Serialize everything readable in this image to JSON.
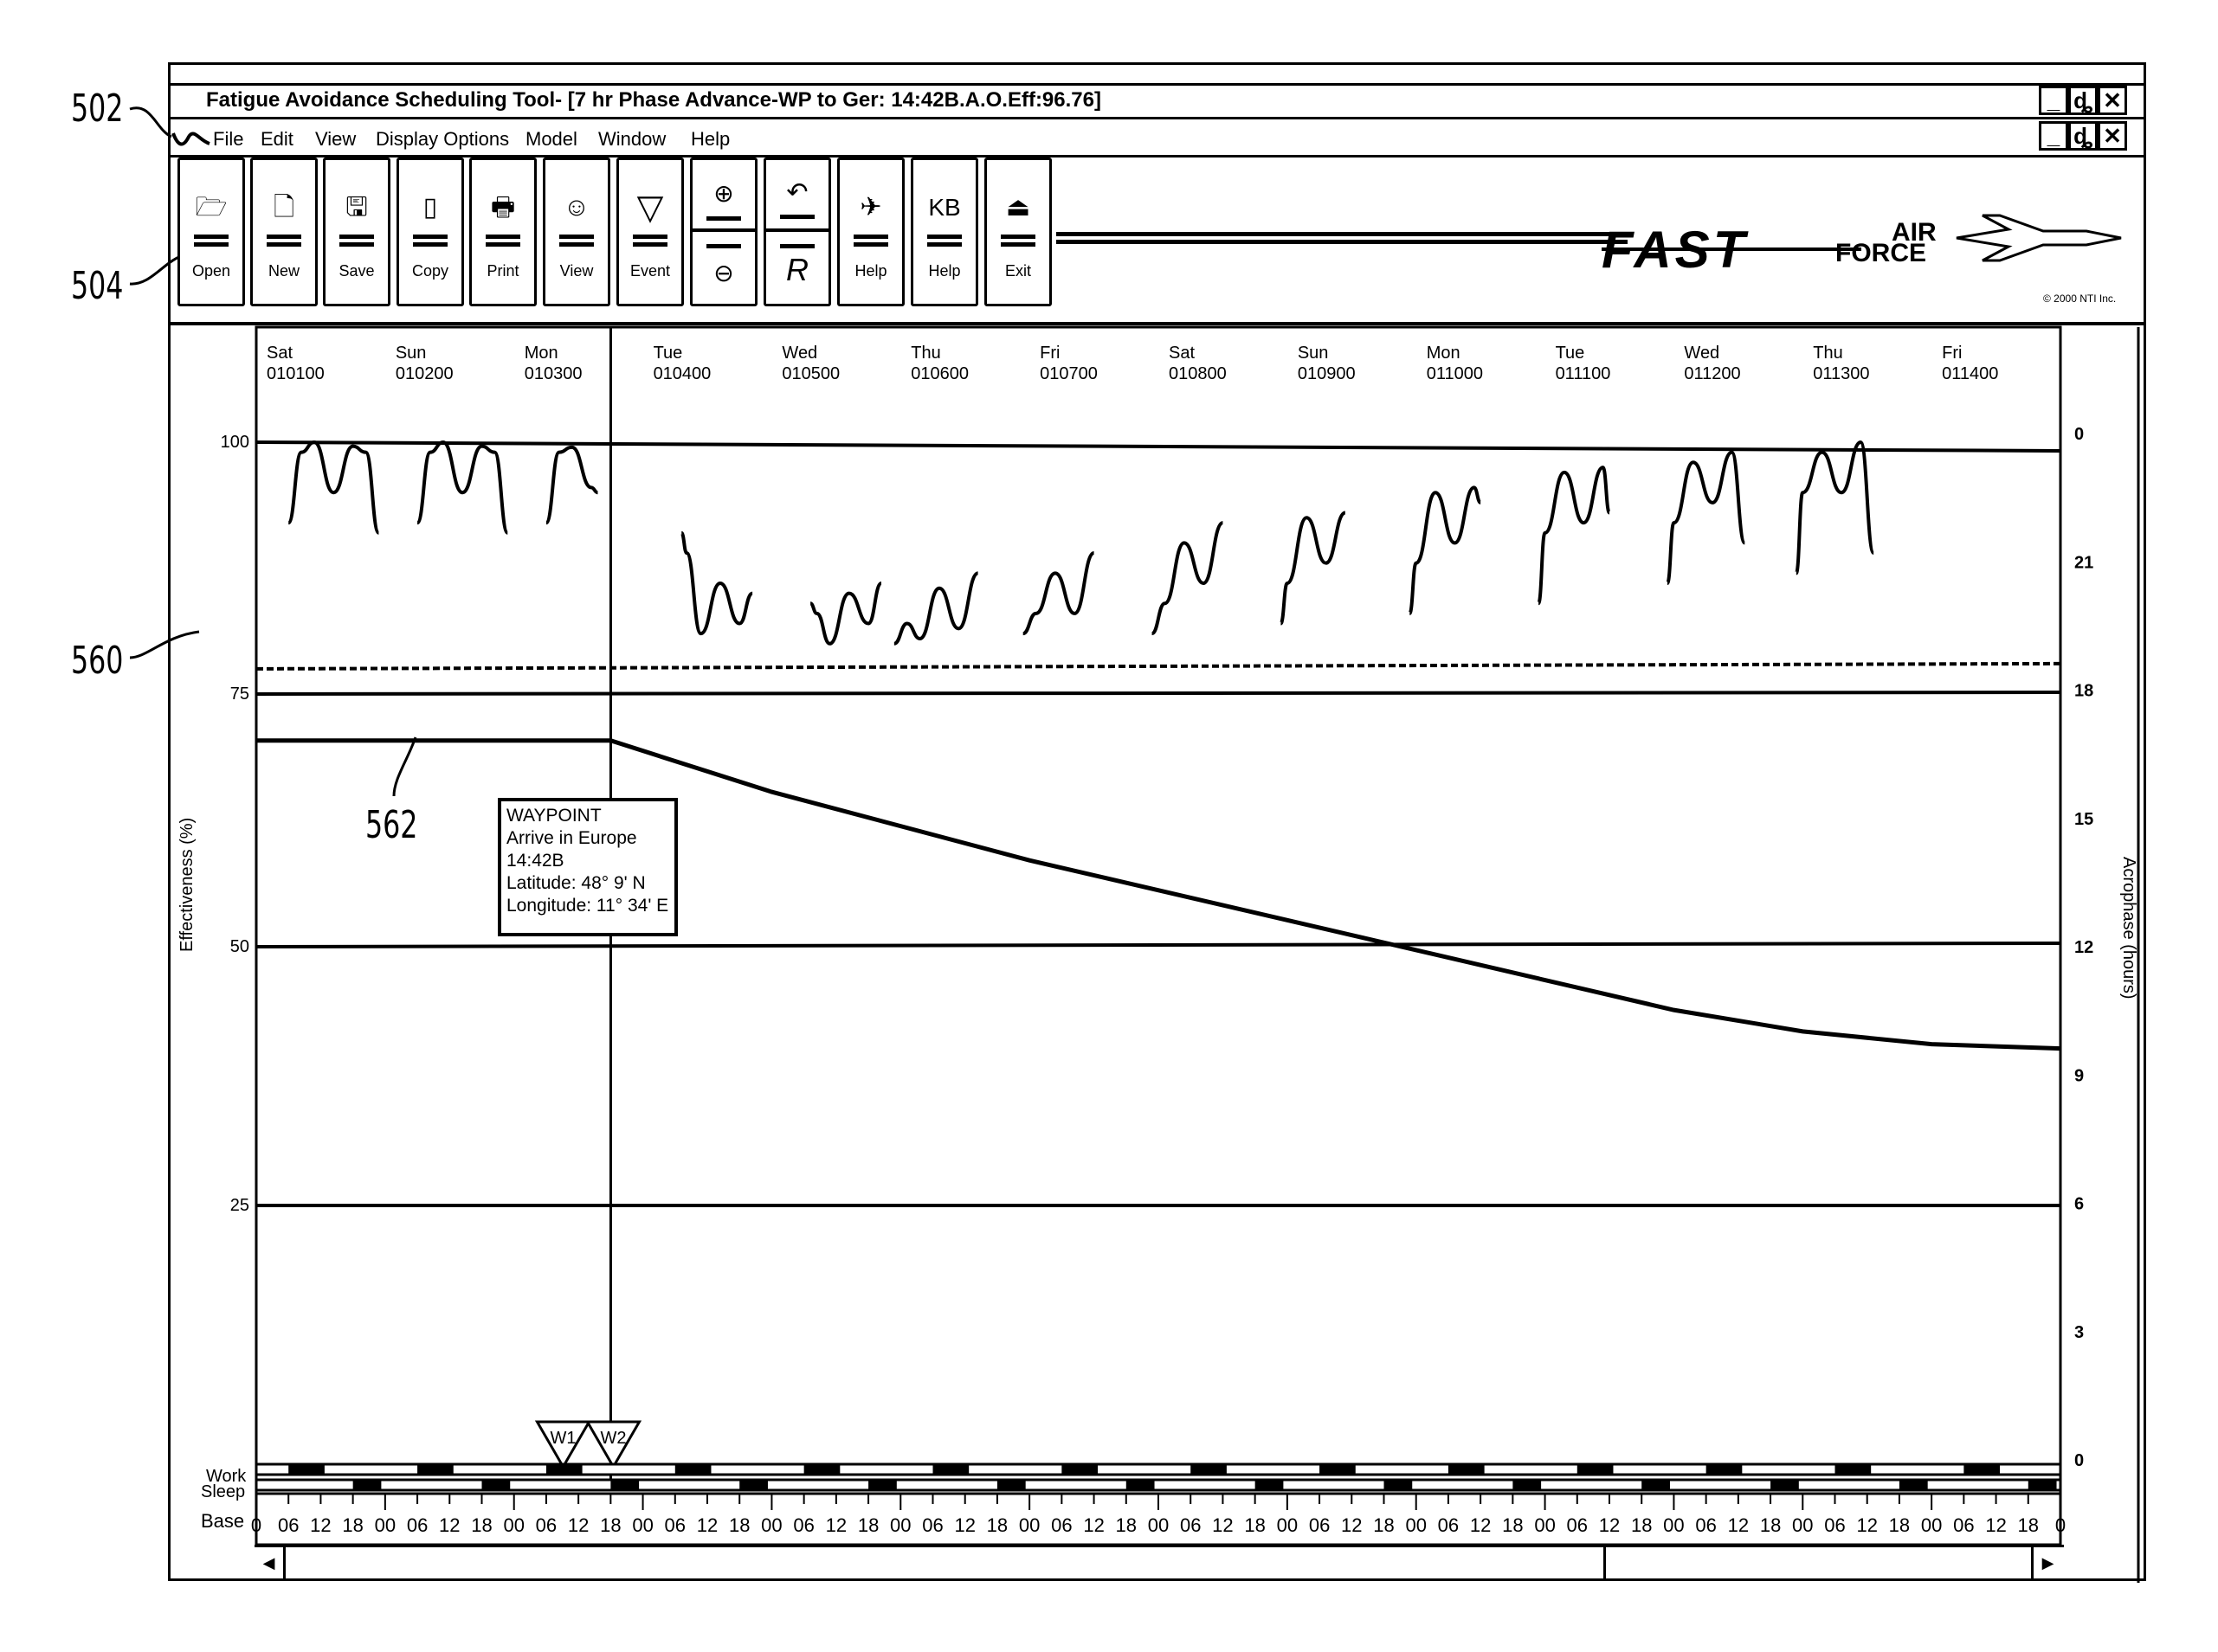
{
  "annotations": {
    "ref_502": "502",
    "ref_504": "504",
    "ref_560": "560",
    "ref_562": "562"
  },
  "window": {
    "title": "Fatigue Avoidance Scheduling Tool- [7 hr Phase Advance-WP to Ger: 14:42B.A.O.Eff:96.76]",
    "controls": {
      "minimize": "_",
      "restore": "ȡ",
      "close": "✕"
    }
  },
  "menu": {
    "app_icon": "wave-icon",
    "items": [
      "File",
      "Edit",
      "View",
      "Display Options",
      "Model",
      "Window",
      "Help"
    ]
  },
  "toolbar": {
    "buttons": [
      {
        "label": "Open",
        "icon": "open-folder-icon",
        "glyph": "🗁"
      },
      {
        "label": "New",
        "icon": "new-document-icon",
        "glyph": "🗋"
      },
      {
        "label": "Save",
        "icon": "save-disk-icon",
        "glyph": "🖫"
      },
      {
        "label": "Copy",
        "icon": "copy-icon",
        "glyph": "▯"
      },
      {
        "label": "Print",
        "icon": "printer-icon",
        "glyph": "🖶"
      },
      {
        "label": "View",
        "icon": "view-character-icon",
        "glyph": "☺"
      },
      {
        "label": "Event",
        "icon": "event-triangle-icon",
        "glyph": "▽"
      },
      {
        "label": "",
        "icon": "zoom-icon",
        "glyph_top": "⊕",
        "glyph_bottom": "⊖"
      },
      {
        "label": "",
        "icon": "undo-reset-icon",
        "glyph_top": "↶",
        "glyph_bottom": "R"
      },
      {
        "label": "Help",
        "icon": "aircraft-help-icon",
        "glyph": "✈"
      },
      {
        "label": "Help",
        "icon": "kb-help-icon",
        "glyph": "KB"
      },
      {
        "label": "Exit",
        "icon": "exit-door-icon",
        "glyph": "⏏"
      }
    ]
  },
  "logo": {
    "fast": "FAST",
    "air": "AIR",
    "force": "FORCE",
    "copyright": "© 2000 NTI Inc."
  },
  "chart_data": {
    "type": "line",
    "title": "",
    "ylabel": "Effectiveness (%)",
    "y2label": "Acrophase (hours)",
    "ylim": [
      0,
      100
    ],
    "y2lim": [
      0,
      24
    ],
    "yticks": [
      100,
      75,
      50,
      25
    ],
    "y2ticks": [
      "0",
      "21",
      "18",
      "15",
      "12",
      "9",
      "6",
      "3",
      "0"
    ],
    "days": [
      {
        "day": "Sat",
        "date": "010100"
      },
      {
        "day": "Sun",
        "date": "010200"
      },
      {
        "day": "Mon",
        "date": "010300"
      },
      {
        "day": "Tue",
        "date": "010400"
      },
      {
        "day": "Wed",
        "date": "010500"
      },
      {
        "day": "Thu",
        "date": "010600"
      },
      {
        "day": "Fri",
        "date": "010700"
      },
      {
        "day": "Sat",
        "date": "010800"
      },
      {
        "day": "Sun",
        "date": "010900"
      },
      {
        "day": "Mon",
        "date": "011000"
      },
      {
        "day": "Tue",
        "date": "011100"
      },
      {
        "day": "Wed",
        "date": "011200"
      },
      {
        "day": "Thu",
        "date": "011300"
      },
      {
        "day": "Fri",
        "date": "011400"
      }
    ],
    "threshold_dashed": 77.5,
    "waypoint_day": 2.65,
    "series": [
      {
        "name": "Effectiveness",
        "segments": [
          [
            [
              0.25,
              92
            ],
            [
              0.35,
              99
            ],
            [
              0.45,
              100
            ],
            [
              0.6,
              95
            ],
            [
              0.75,
              99.6
            ],
            [
              0.85,
              99
            ],
            [
              0.95,
              91
            ]
          ],
          [
            [
              1.25,
              92
            ],
            [
              1.35,
              99
            ],
            [
              1.45,
              100
            ],
            [
              1.6,
              95
            ],
            [
              1.75,
              99.6
            ],
            [
              1.85,
              99
            ],
            [
              1.95,
              91
            ]
          ],
          [
            [
              2.25,
              92
            ],
            [
              2.35,
              99
            ],
            [
              2.45,
              99.5
            ],
            [
              2.6,
              95.5
            ],
            [
              2.65,
              95
            ]
          ],
          [
            [
              3.3,
              91
            ],
            [
              3.34,
              89
            ],
            [
              3.45,
              81
            ],
            [
              3.6,
              86
            ],
            [
              3.75,
              82
            ],
            [
              3.85,
              85
            ]
          ],
          [
            [
              4.3,
              84
            ],
            [
              4.35,
              83
            ],
            [
              4.45,
              80
            ],
            [
              4.6,
              85
            ],
            [
              4.75,
              82
            ],
            [
              4.85,
              86
            ]
          ],
          [
            [
              4.95,
              80
            ],
            [
              5.05,
              82
            ],
            [
              5.15,
              80.5
            ],
            [
              5.3,
              85.5
            ],
            [
              5.45,
              81.5
            ],
            [
              5.6,
              87
            ]
          ],
          [
            [
              5.95,
              81
            ],
            [
              6.05,
              83
            ],
            [
              6.2,
              87
            ],
            [
              6.35,
              83
            ],
            [
              6.5,
              89
            ]
          ],
          [
            [
              6.95,
              81
            ],
            [
              7.05,
              84
            ],
            [
              7.2,
              90
            ],
            [
              7.35,
              86
            ],
            [
              7.5,
              92
            ]
          ],
          [
            [
              7.95,
              82
            ],
            [
              8.0,
              86
            ],
            [
              8.15,
              92.5
            ],
            [
              8.3,
              88
            ],
            [
              8.45,
              93
            ]
          ],
          [
            [
              8.95,
              83
            ],
            [
              9.0,
              88
            ],
            [
              9.15,
              95
            ],
            [
              9.3,
              90
            ],
            [
              9.45,
              95.5
            ],
            [
              9.5,
              94
            ]
          ],
          [
            [
              9.95,
              84
            ],
            [
              10.0,
              91
            ],
            [
              10.15,
              97
            ],
            [
              10.3,
              92
            ],
            [
              10.45,
              97.5
            ],
            [
              10.5,
              93
            ]
          ],
          [
            [
              10.95,
              86
            ],
            [
              11.0,
              92
            ],
            [
              11.15,
              98
            ],
            [
              11.3,
              94
            ],
            [
              11.45,
              99
            ],
            [
              11.55,
              90
            ]
          ],
          [
            [
              11.95,
              87
            ],
            [
              12.0,
              95
            ],
            [
              12.15,
              99
            ],
            [
              12.3,
              95
            ],
            [
              12.45,
              100
            ],
            [
              12.55,
              89
            ]
          ]
        ]
      },
      {
        "name": "Acrophase",
        "axis": "right",
        "points": [
          [
            0,
            16.8
          ],
          [
            2.65,
            16.8
          ],
          [
            4,
            15.6
          ],
          [
            6,
            14
          ],
          [
            8,
            12.6
          ],
          [
            10,
            11.2
          ],
          [
            11,
            10.5
          ],
          [
            12,
            10
          ],
          [
            13,
            9.7
          ],
          [
            14,
            9.6
          ]
        ]
      }
    ],
    "waypoint_markers": [
      "W1",
      "W2"
    ],
    "row_labels": {
      "work": "Work",
      "sleep": "Sleep",
      "base": "Base"
    },
    "base_ticks": [
      "0",
      "06",
      "12",
      "18",
      "00",
      "06",
      "12",
      "18",
      "00",
      "06",
      "12",
      "18",
      "00",
      "06",
      "12",
      "18",
      "00",
      "06",
      "12",
      "18",
      "00",
      "06",
      "12",
      "18",
      "00",
      "06",
      "12",
      "18",
      "00",
      "06",
      "12",
      "18",
      "00",
      "06",
      "12",
      "18",
      "00",
      "06",
      "12",
      "18",
      "00",
      "06",
      "12",
      "18",
      "00",
      "06",
      "12",
      "18",
      "00",
      "06",
      "12",
      "18",
      "00",
      "06",
      "12",
      "18",
      "0"
    ]
  },
  "tooltip": {
    "lines": [
      "WAYPOINT",
      "Arrive in Europe",
      "14:42B",
      "Latitude: 48° 9' N",
      "Longitude: 11° 34' E"
    ]
  },
  "scrollbar": {
    "left_arrow": "◀",
    "right_arrow": "▶"
  }
}
